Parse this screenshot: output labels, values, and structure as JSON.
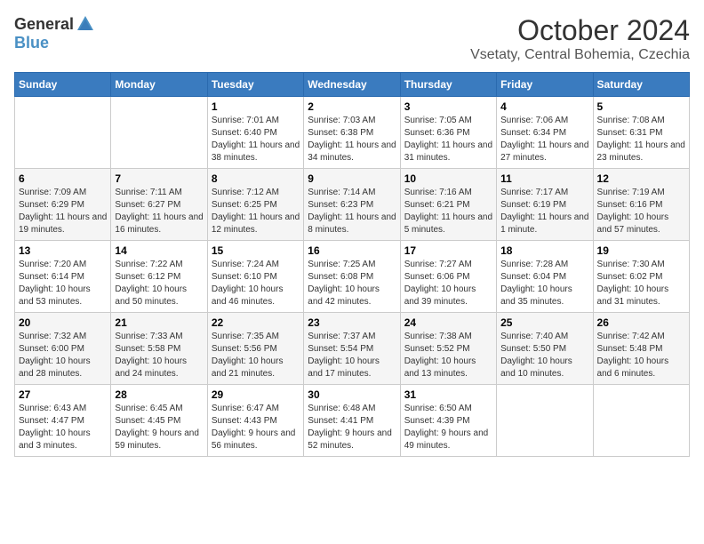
{
  "header": {
    "logo_general": "General",
    "logo_blue": "Blue",
    "month_title": "October 2024",
    "location": "Vsetaty, Central Bohemia, Czechia"
  },
  "days_of_week": [
    "Sunday",
    "Monday",
    "Tuesday",
    "Wednesday",
    "Thursday",
    "Friday",
    "Saturday"
  ],
  "weeks": [
    [
      {
        "day": "",
        "info": ""
      },
      {
        "day": "",
        "info": ""
      },
      {
        "day": "1",
        "info": "Sunrise: 7:01 AM\nSunset: 6:40 PM\nDaylight: 11 hours and 38 minutes."
      },
      {
        "day": "2",
        "info": "Sunrise: 7:03 AM\nSunset: 6:38 PM\nDaylight: 11 hours and 34 minutes."
      },
      {
        "day": "3",
        "info": "Sunrise: 7:05 AM\nSunset: 6:36 PM\nDaylight: 11 hours and 31 minutes."
      },
      {
        "day": "4",
        "info": "Sunrise: 7:06 AM\nSunset: 6:34 PM\nDaylight: 11 hours and 27 minutes."
      },
      {
        "day": "5",
        "info": "Sunrise: 7:08 AM\nSunset: 6:31 PM\nDaylight: 11 hours and 23 minutes."
      }
    ],
    [
      {
        "day": "6",
        "info": "Sunrise: 7:09 AM\nSunset: 6:29 PM\nDaylight: 11 hours and 19 minutes."
      },
      {
        "day": "7",
        "info": "Sunrise: 7:11 AM\nSunset: 6:27 PM\nDaylight: 11 hours and 16 minutes."
      },
      {
        "day": "8",
        "info": "Sunrise: 7:12 AM\nSunset: 6:25 PM\nDaylight: 11 hours and 12 minutes."
      },
      {
        "day": "9",
        "info": "Sunrise: 7:14 AM\nSunset: 6:23 PM\nDaylight: 11 hours and 8 minutes."
      },
      {
        "day": "10",
        "info": "Sunrise: 7:16 AM\nSunset: 6:21 PM\nDaylight: 11 hours and 5 minutes."
      },
      {
        "day": "11",
        "info": "Sunrise: 7:17 AM\nSunset: 6:19 PM\nDaylight: 11 hours and 1 minute."
      },
      {
        "day": "12",
        "info": "Sunrise: 7:19 AM\nSunset: 6:16 PM\nDaylight: 10 hours and 57 minutes."
      }
    ],
    [
      {
        "day": "13",
        "info": "Sunrise: 7:20 AM\nSunset: 6:14 PM\nDaylight: 10 hours and 53 minutes."
      },
      {
        "day": "14",
        "info": "Sunrise: 7:22 AM\nSunset: 6:12 PM\nDaylight: 10 hours and 50 minutes."
      },
      {
        "day": "15",
        "info": "Sunrise: 7:24 AM\nSunset: 6:10 PM\nDaylight: 10 hours and 46 minutes."
      },
      {
        "day": "16",
        "info": "Sunrise: 7:25 AM\nSunset: 6:08 PM\nDaylight: 10 hours and 42 minutes."
      },
      {
        "day": "17",
        "info": "Sunrise: 7:27 AM\nSunset: 6:06 PM\nDaylight: 10 hours and 39 minutes."
      },
      {
        "day": "18",
        "info": "Sunrise: 7:28 AM\nSunset: 6:04 PM\nDaylight: 10 hours and 35 minutes."
      },
      {
        "day": "19",
        "info": "Sunrise: 7:30 AM\nSunset: 6:02 PM\nDaylight: 10 hours and 31 minutes."
      }
    ],
    [
      {
        "day": "20",
        "info": "Sunrise: 7:32 AM\nSunset: 6:00 PM\nDaylight: 10 hours and 28 minutes."
      },
      {
        "day": "21",
        "info": "Sunrise: 7:33 AM\nSunset: 5:58 PM\nDaylight: 10 hours and 24 minutes."
      },
      {
        "day": "22",
        "info": "Sunrise: 7:35 AM\nSunset: 5:56 PM\nDaylight: 10 hours and 21 minutes."
      },
      {
        "day": "23",
        "info": "Sunrise: 7:37 AM\nSunset: 5:54 PM\nDaylight: 10 hours and 17 minutes."
      },
      {
        "day": "24",
        "info": "Sunrise: 7:38 AM\nSunset: 5:52 PM\nDaylight: 10 hours and 13 minutes."
      },
      {
        "day": "25",
        "info": "Sunrise: 7:40 AM\nSunset: 5:50 PM\nDaylight: 10 hours and 10 minutes."
      },
      {
        "day": "26",
        "info": "Sunrise: 7:42 AM\nSunset: 5:48 PM\nDaylight: 10 hours and 6 minutes."
      }
    ],
    [
      {
        "day": "27",
        "info": "Sunrise: 6:43 AM\nSunset: 4:47 PM\nDaylight: 10 hours and 3 minutes."
      },
      {
        "day": "28",
        "info": "Sunrise: 6:45 AM\nSunset: 4:45 PM\nDaylight: 9 hours and 59 minutes."
      },
      {
        "day": "29",
        "info": "Sunrise: 6:47 AM\nSunset: 4:43 PM\nDaylight: 9 hours and 56 minutes."
      },
      {
        "day": "30",
        "info": "Sunrise: 6:48 AM\nSunset: 4:41 PM\nDaylight: 9 hours and 52 minutes."
      },
      {
        "day": "31",
        "info": "Sunrise: 6:50 AM\nSunset: 4:39 PM\nDaylight: 9 hours and 49 minutes."
      },
      {
        "day": "",
        "info": ""
      },
      {
        "day": "",
        "info": ""
      }
    ]
  ]
}
